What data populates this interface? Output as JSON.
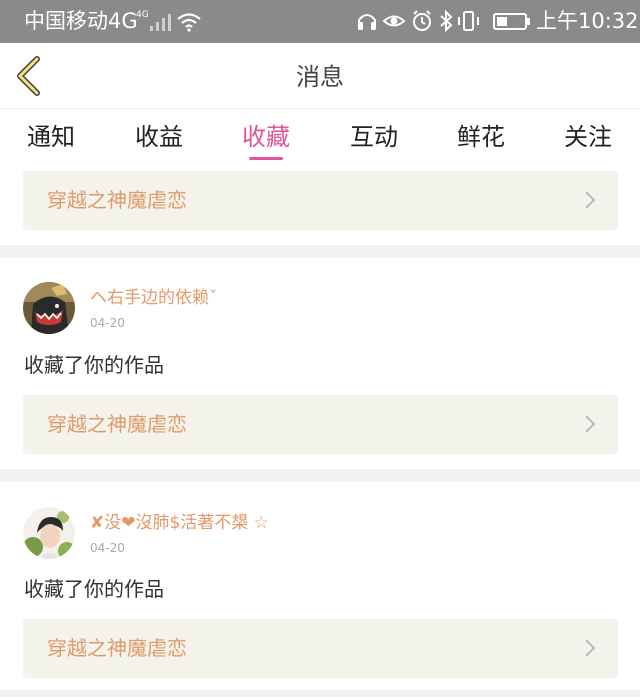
{
  "status_bar": {
    "carrier": "中国移动4G",
    "signal_tag": "4G",
    "time": "上午10:32"
  },
  "header": {
    "title": "消息",
    "back_icon": "chevron-left-icon"
  },
  "tabs": [
    {
      "label": "通知",
      "active": false
    },
    {
      "label": "收益",
      "active": false
    },
    {
      "label": "收藏",
      "active": true
    },
    {
      "label": "互动",
      "active": false
    },
    {
      "label": "鲜花",
      "active": false
    },
    {
      "label": "关注",
      "active": false
    }
  ],
  "colors": {
    "accent": "#e0559a",
    "work_link_text": "#e4996a",
    "card_bg": "#f3f3ec",
    "status_bar_bg": "#8a8a8a"
  },
  "top_item": {
    "work_title": "穿越之神魔虐恋"
  },
  "items": [
    {
      "username": "ヘ右手边的依赖ˇ",
      "date": "04-20",
      "action": "收藏了你的作品",
      "work_title": "穿越之神魔虐恋"
    },
    {
      "username": "✘没❤沒肺$活著不槼 ☆",
      "date": "04-20",
      "action": "收藏了你的作品",
      "work_title": "穿越之神魔虐恋"
    }
  ]
}
